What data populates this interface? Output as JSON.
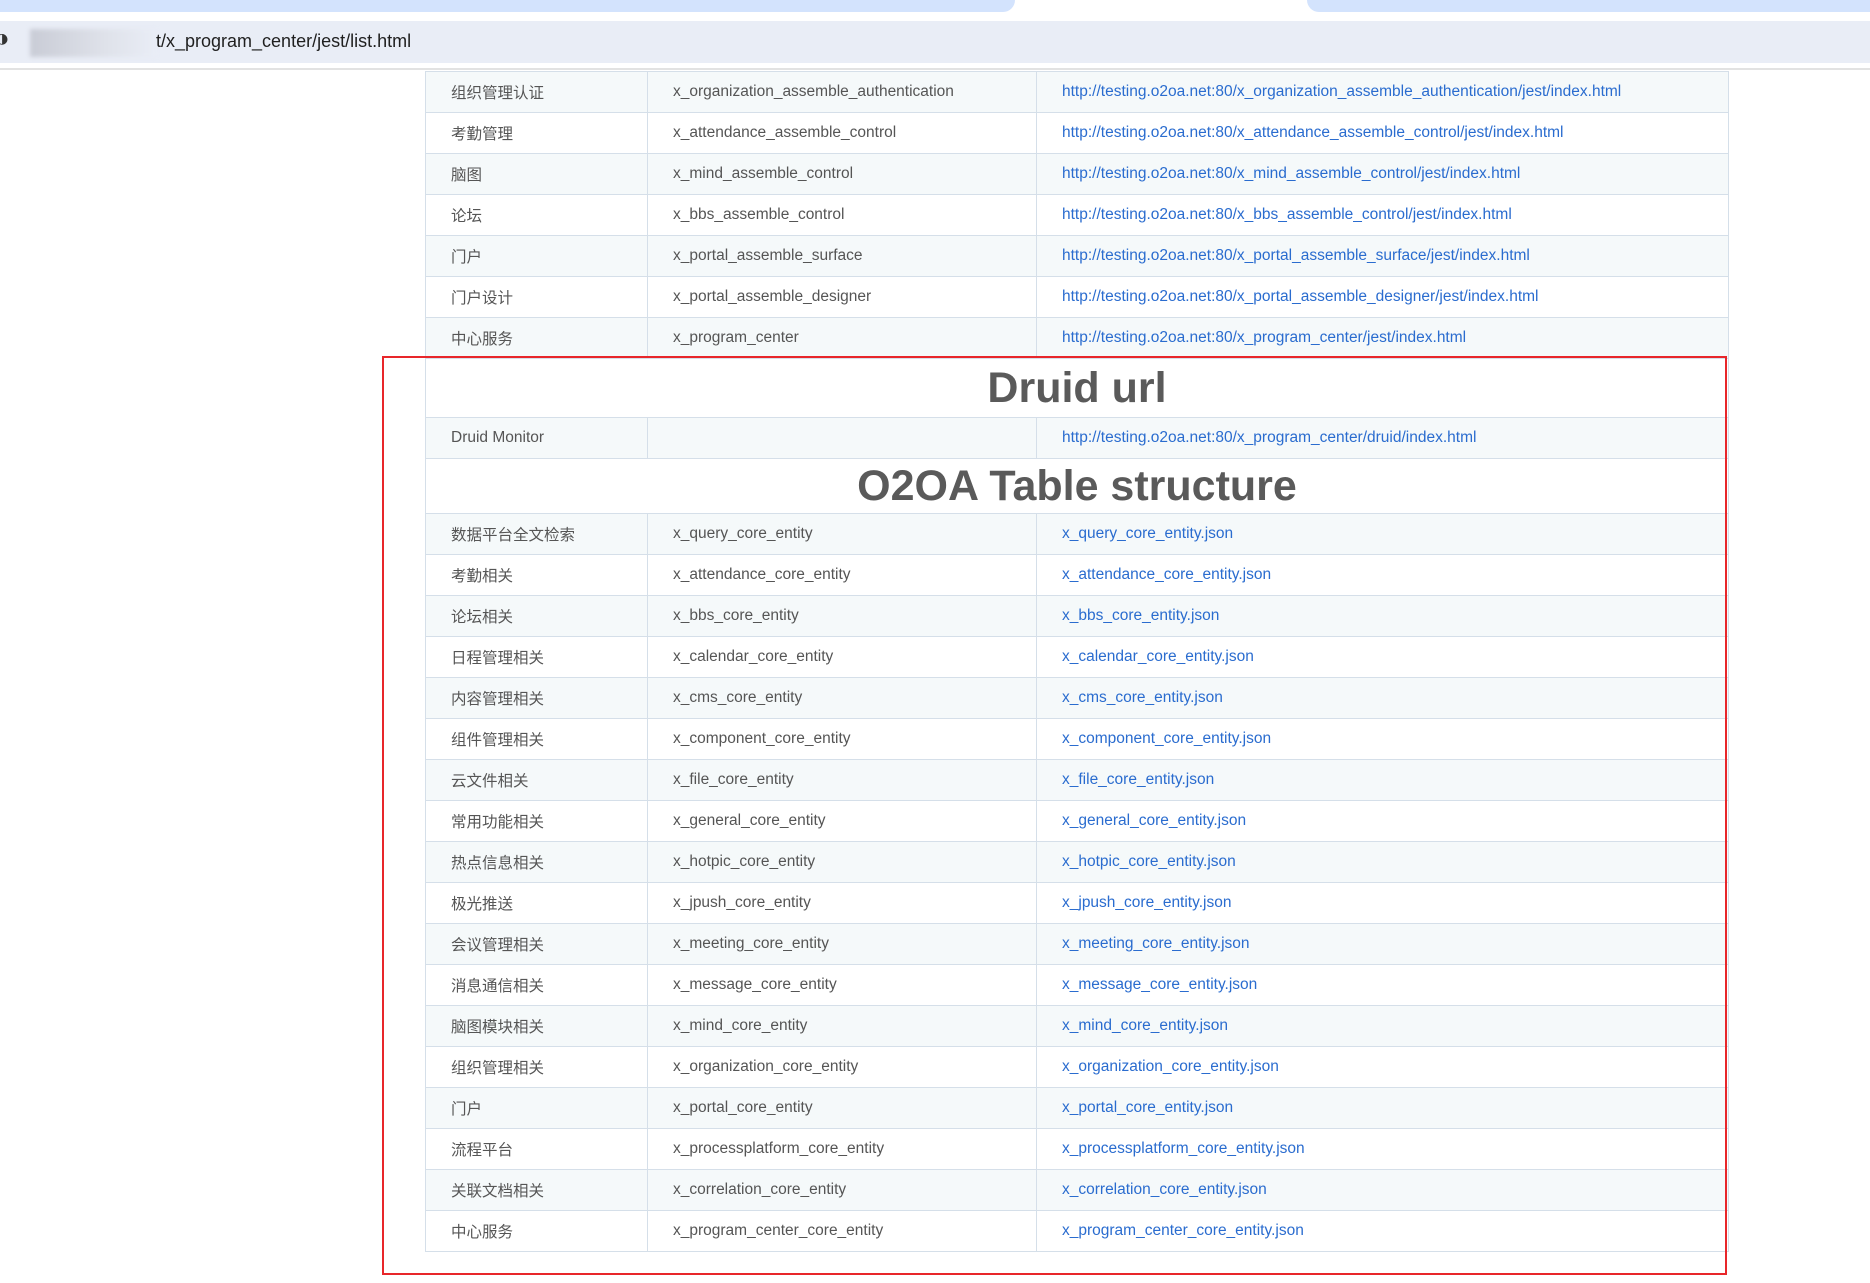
{
  "browser": {
    "url_visible": "t/x_program_center/jest/list.html"
  },
  "services": [
    {
      "name": "组织管理认证",
      "module": "x_organization_assemble_authentication",
      "url": "http://testing.o2oa.net:80/x_organization_assemble_authentication/jest/index.html"
    },
    {
      "name": "考勤管理",
      "module": "x_attendance_assemble_control",
      "url": "http://testing.o2oa.net:80/x_attendance_assemble_control/jest/index.html"
    },
    {
      "name": "脑图",
      "module": "x_mind_assemble_control",
      "url": "http://testing.o2oa.net:80/x_mind_assemble_control/jest/index.html"
    },
    {
      "name": "论坛",
      "module": "x_bbs_assemble_control",
      "url": "http://testing.o2oa.net:80/x_bbs_assemble_control/jest/index.html"
    },
    {
      "name": "门户",
      "module": "x_portal_assemble_surface",
      "url": "http://testing.o2oa.net:80/x_portal_assemble_surface/jest/index.html"
    },
    {
      "name": "门户设计",
      "module": "x_portal_assemble_designer",
      "url": "http://testing.o2oa.net:80/x_portal_assemble_designer/jest/index.html"
    },
    {
      "name": "中心服务",
      "module": "x_program_center",
      "url": "http://testing.o2oa.net:80/x_program_center/jest/index.html"
    }
  ],
  "druid": {
    "heading": "Druid url",
    "name": "Druid Monitor",
    "module": "",
    "url": "http://testing.o2oa.net:80/x_program_center/druid/index.html"
  },
  "tables": {
    "heading": "O2OA Table structure",
    "rows": [
      {
        "name": "数据平台全文检索",
        "module": "x_query_core_entity",
        "file": "x_query_core_entity.json"
      },
      {
        "name": "考勤相关",
        "module": "x_attendance_core_entity",
        "file": "x_attendance_core_entity.json"
      },
      {
        "name": "论坛相关",
        "module": "x_bbs_core_entity",
        "file": "x_bbs_core_entity.json"
      },
      {
        "name": "日程管理相关",
        "module": "x_calendar_core_entity",
        "file": "x_calendar_core_entity.json"
      },
      {
        "name": "内容管理相关",
        "module": "x_cms_core_entity",
        "file": "x_cms_core_entity.json"
      },
      {
        "name": "组件管理相关",
        "module": "x_component_core_entity",
        "file": "x_component_core_entity.json"
      },
      {
        "name": "云文件相关",
        "module": "x_file_core_entity",
        "file": "x_file_core_entity.json"
      },
      {
        "name": "常用功能相关",
        "module": "x_general_core_entity",
        "file": "x_general_core_entity.json"
      },
      {
        "name": "热点信息相关",
        "module": "x_hotpic_core_entity",
        "file": "x_hotpic_core_entity.json"
      },
      {
        "name": "极光推送",
        "module": "x_jpush_core_entity",
        "file": "x_jpush_core_entity.json"
      },
      {
        "name": "会议管理相关",
        "module": "x_meeting_core_entity",
        "file": "x_meeting_core_entity.json"
      },
      {
        "name": "消息通信相关",
        "module": "x_message_core_entity",
        "file": "x_message_core_entity.json"
      },
      {
        "name": "脑图模块相关",
        "module": "x_mind_core_entity",
        "file": "x_mind_core_entity.json"
      },
      {
        "name": "组织管理相关",
        "module": "x_organization_core_entity",
        "file": "x_organization_core_entity.json"
      },
      {
        "name": "门户",
        "module": "x_portal_core_entity",
        "file": "x_portal_core_entity.json"
      },
      {
        "name": "流程平台",
        "module": "x_processplatform_core_entity",
        "file": "x_processplatform_core_entity.json"
      },
      {
        "name": "关联文档相关",
        "module": "x_correlation_core_entity",
        "file": "x_correlation_core_entity.json"
      },
      {
        "name": "中心服务",
        "module": "x_program_center_core_entity",
        "file": "x_program_center_core_entity.json"
      }
    ]
  },
  "colors": {
    "link": "#2a6ccf",
    "highlight_box": "#e8262a"
  }
}
